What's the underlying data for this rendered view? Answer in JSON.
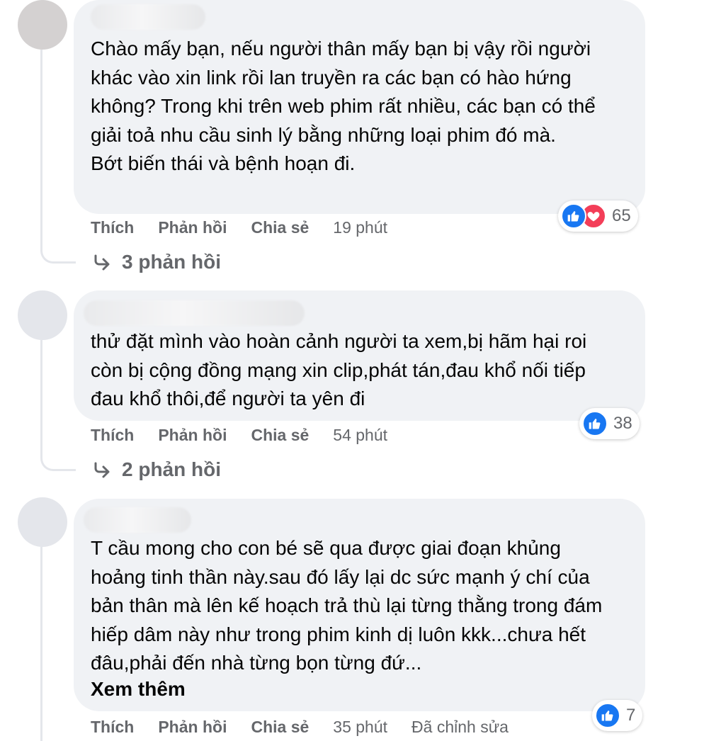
{
  "comments": [
    {
      "text": "Chào mấy bạn, nếu người thân mấy bạn bị vậy rồi người khác vào xin link rồi lan truyền ra các bạn có hào hứng không? Trong khi trên web phim rất nhiều, các bạn có thể giải toả nhu cầu sinh lý bằng những loại phim đó mà.",
      "text2": "Bớt biến thái và bệnh hoạn đi.",
      "actions": {
        "like": "Thích",
        "reply": "Phản hồi",
        "share": "Chia sẻ"
      },
      "time": "19 phút",
      "reactions": {
        "types": [
          "like-icon",
          "love-icon"
        ],
        "count": "65"
      },
      "replies": "3 phản hồi"
    },
    {
      "text": "thử đặt mình vào hoàn cảnh người ta xem,bị hãm hại roi còn bị cộng đồng mạng xin clip,phát tán,đau khổ nối tiếp đau khổ thôi,để người ta yên đi",
      "actions": {
        "like": "Thích",
        "reply": "Phản hồi",
        "share": "Chia sẻ"
      },
      "time": "54 phút",
      "reactions": {
        "types": [
          "like-icon"
        ],
        "count": "38"
      },
      "replies": "2 phản hồi"
    },
    {
      "text": "T cầu mong cho con bé sẽ qua được giai đoạn khủng hoảng tinh thần này.sau đó lấy lại dc sức mạnh ý chí của bản thân mà lên kế hoạch trả thù lại từng thằng trong đám hiếp dâm này như trong phim kinh dị luôn kkk...chưa hết đâu,phải đến nhà từng bọn từng đứ...",
      "see_more": "Xem thêm",
      "actions": {
        "like": "Thích",
        "reply": "Phản hồi",
        "share": "Chia sẻ"
      },
      "time": "35 phút",
      "edited": "Đã chỉnh sửa",
      "reactions": {
        "types": [
          "like-icon"
        ],
        "count": "7"
      }
    }
  ],
  "colors": {
    "bubble": "#f0f2f5",
    "text": "#050505",
    "secondary": "#65676b",
    "like": "#1877f2",
    "love": "#f33e58"
  }
}
